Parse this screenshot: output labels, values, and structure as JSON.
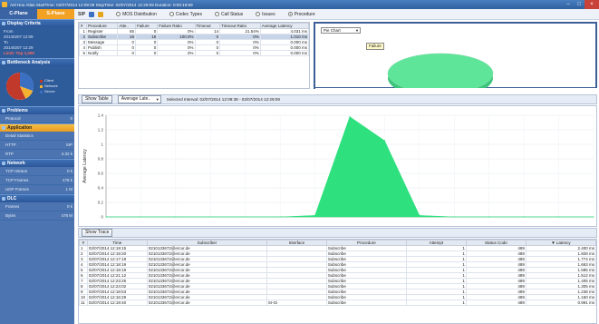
{
  "window": {
    "title": "Ael Hou Atlas   StartTime: 02/07/2014 12:09:38   StopTime: 02/07/2014 12:29:09   Duration: 0:00:19:59"
  },
  "left": {
    "planes": [
      "C-Plane",
      "S-Plane"
    ],
    "display_criteria": {
      "header": "Display Criteria",
      "lines": [
        "From",
        "20140207 12:09",
        "To",
        "20140207 12:29",
        "Limit: Top 1,000"
      ]
    },
    "bottleneck": {
      "header": "Bottleneck Analysis",
      "legend": [
        "Client",
        "Network",
        "Server"
      ],
      "pie": [
        {
          "label": "Client",
          "value": 55,
          "color": "#c0392b"
        },
        {
          "label": "Network",
          "value": 15,
          "color": "#f5b130"
        },
        {
          "label": "Server",
          "value": 30,
          "color": "#3b6fc2"
        }
      ]
    },
    "problems": {
      "header": "Problems",
      "rows": [
        {
          "label": "Protocol",
          "value": "0"
        }
      ]
    },
    "application": {
      "header": "Application",
      "rows": [
        {
          "label": "Detail Statistics",
          "value": ""
        },
        {
          "label": "HTTP",
          "value": "SIP"
        },
        {
          "label": "RTP",
          "value": "4.32 k"
        }
      ]
    },
    "network": {
      "header": "Network",
      "rows": [
        {
          "label": "TCP retrans",
          "value": "0 k"
        },
        {
          "label": "TCP Frames",
          "value": "478 k"
        },
        {
          "label": "UDP Frames",
          "value": "1 M"
        }
      ]
    },
    "dlc": {
      "header": "DLC",
      "rows": [
        {
          "label": "Frames",
          "value": "0 k"
        },
        {
          "label": "Bytes",
          "value": "478 M"
        }
      ]
    }
  },
  "toolbar": {
    "sip": "SIP",
    "radios": [
      {
        "label": "MOS Distribution",
        "on": false
      },
      {
        "label": "Codec Types",
        "on": false
      },
      {
        "label": "Call Status",
        "on": false
      },
      {
        "label": "Issues",
        "on": false
      },
      {
        "label": "Procedure",
        "on": true
      }
    ]
  },
  "summary": {
    "columns": [
      "#",
      "Procedure",
      "Atte..",
      "Failure",
      "Failure Ratio",
      "Timeout",
      "Timeout Ratio",
      "Average Latency"
    ],
    "rows": [
      [
        "1",
        "Register",
        "65",
        "0",
        "0%",
        "14",
        "21.54%",
        "4.031 ms"
      ],
      [
        "2",
        "Subscribe",
        "16",
        "16",
        "100.0%",
        "0",
        "0%",
        "1.010 ms"
      ],
      [
        "3",
        "Message",
        "0",
        "0",
        "0%",
        "0",
        "0%",
        "0.000 ms"
      ],
      [
        "4",
        "Publish",
        "0",
        "0",
        "0%",
        "0",
        "0%",
        "0.000 ms"
      ],
      [
        "5",
        "Notify",
        "0",
        "0",
        "0%",
        "0",
        "0%",
        "0.000 ms"
      ]
    ],
    "selected_row": 1
  },
  "pie_panel": {
    "select": "Pie Chart",
    "tooltip": "Failure",
    "slice_color": "#5ee59a"
  },
  "midbar": {
    "button": "Show Table",
    "select": "Average Late..",
    "interval": "Selected Interval: 02/07/2014 12:09:38 - 02/07/2014 12:29:09"
  },
  "chart_data": {
    "type": "area",
    "ylabel": "Average Latency",
    "yticks": [
      "1.4",
      "1.2",
      "1",
      "0.8",
      "0.6",
      "0.4",
      "0.2",
      "0"
    ],
    "ylim": [
      0,
      1.4
    ],
    "x": [
      0,
      1,
      2,
      3,
      4,
      5,
      6,
      7,
      8,
      9,
      10,
      11,
      12,
      13,
      14
    ],
    "values": [
      0,
      0,
      0,
      0,
      0,
      0,
      0.02,
      1.38,
      1.05,
      0.02,
      0,
      0,
      0,
      0,
      0
    ],
    "color": "#2ee07e",
    "grid": true
  },
  "lower": {
    "button": "Show Trace",
    "columns": [
      "#",
      "Time",
      "Subscriber",
      "Interface",
      "Procedure",
      "Attempt",
      "Status Code",
      "Latency"
    ],
    "rows": [
      [
        "1",
        "02/07/2014 12:19:15",
        "0210133672@ercor.de",
        "",
        "Subscribe",
        "1",
        "489",
        "2.400 ms"
      ],
      [
        "2",
        "02/07/2014 12:19:20",
        "0210133672@ercor.de",
        "",
        "Subscribe",
        "1",
        "489",
        "1.828 ms"
      ],
      [
        "3",
        "02/07/2014 12:17:19",
        "0210133672@ercor.de",
        "",
        "Subscribe",
        "1",
        "489",
        "1.774 ms"
      ],
      [
        "4",
        "02/07/2014 12:18:19",
        "0210133672@ercor.de",
        "",
        "Subscribe",
        "1",
        "489",
        "1.663 ms"
      ],
      [
        "5",
        "02/07/2014 12:18:19",
        "0210133672@ercor.de",
        "",
        "Subscribe",
        "1",
        "489",
        "1.585 ms"
      ],
      [
        "6",
        "02/07/2014 12:21:12",
        "0210133672@ercor.de",
        "",
        "Subscribe",
        "1",
        "489",
        "1.512 ms"
      ],
      [
        "7",
        "02/07/2014 12:23:25",
        "0210133672@ercor.de",
        "",
        "Subscribe",
        "1",
        "489",
        "1.405 ms"
      ],
      [
        "8",
        "02/07/2014 12:24:02",
        "0210133672@ercor.de",
        "",
        "Subscribe",
        "1",
        "489",
        "1.305 ms"
      ],
      [
        "9",
        "02/07/2014 12:18:53",
        "0210133672@ercor.de",
        "",
        "Subscribe",
        "1",
        "489",
        "1.238 ms"
      ],
      [
        "10",
        "02/07/2014 12:16:29",
        "0210133672@ercor.de",
        "",
        "Subscribe",
        "1",
        "489",
        "1.160 ms"
      ],
      [
        "11",
        "02/07/2014 12:19:40",
        "0210133672@ercor.de",
        "SI-Gi",
        "Subscribe",
        "1",
        "489",
        "0.991 ms"
      ]
    ]
  }
}
